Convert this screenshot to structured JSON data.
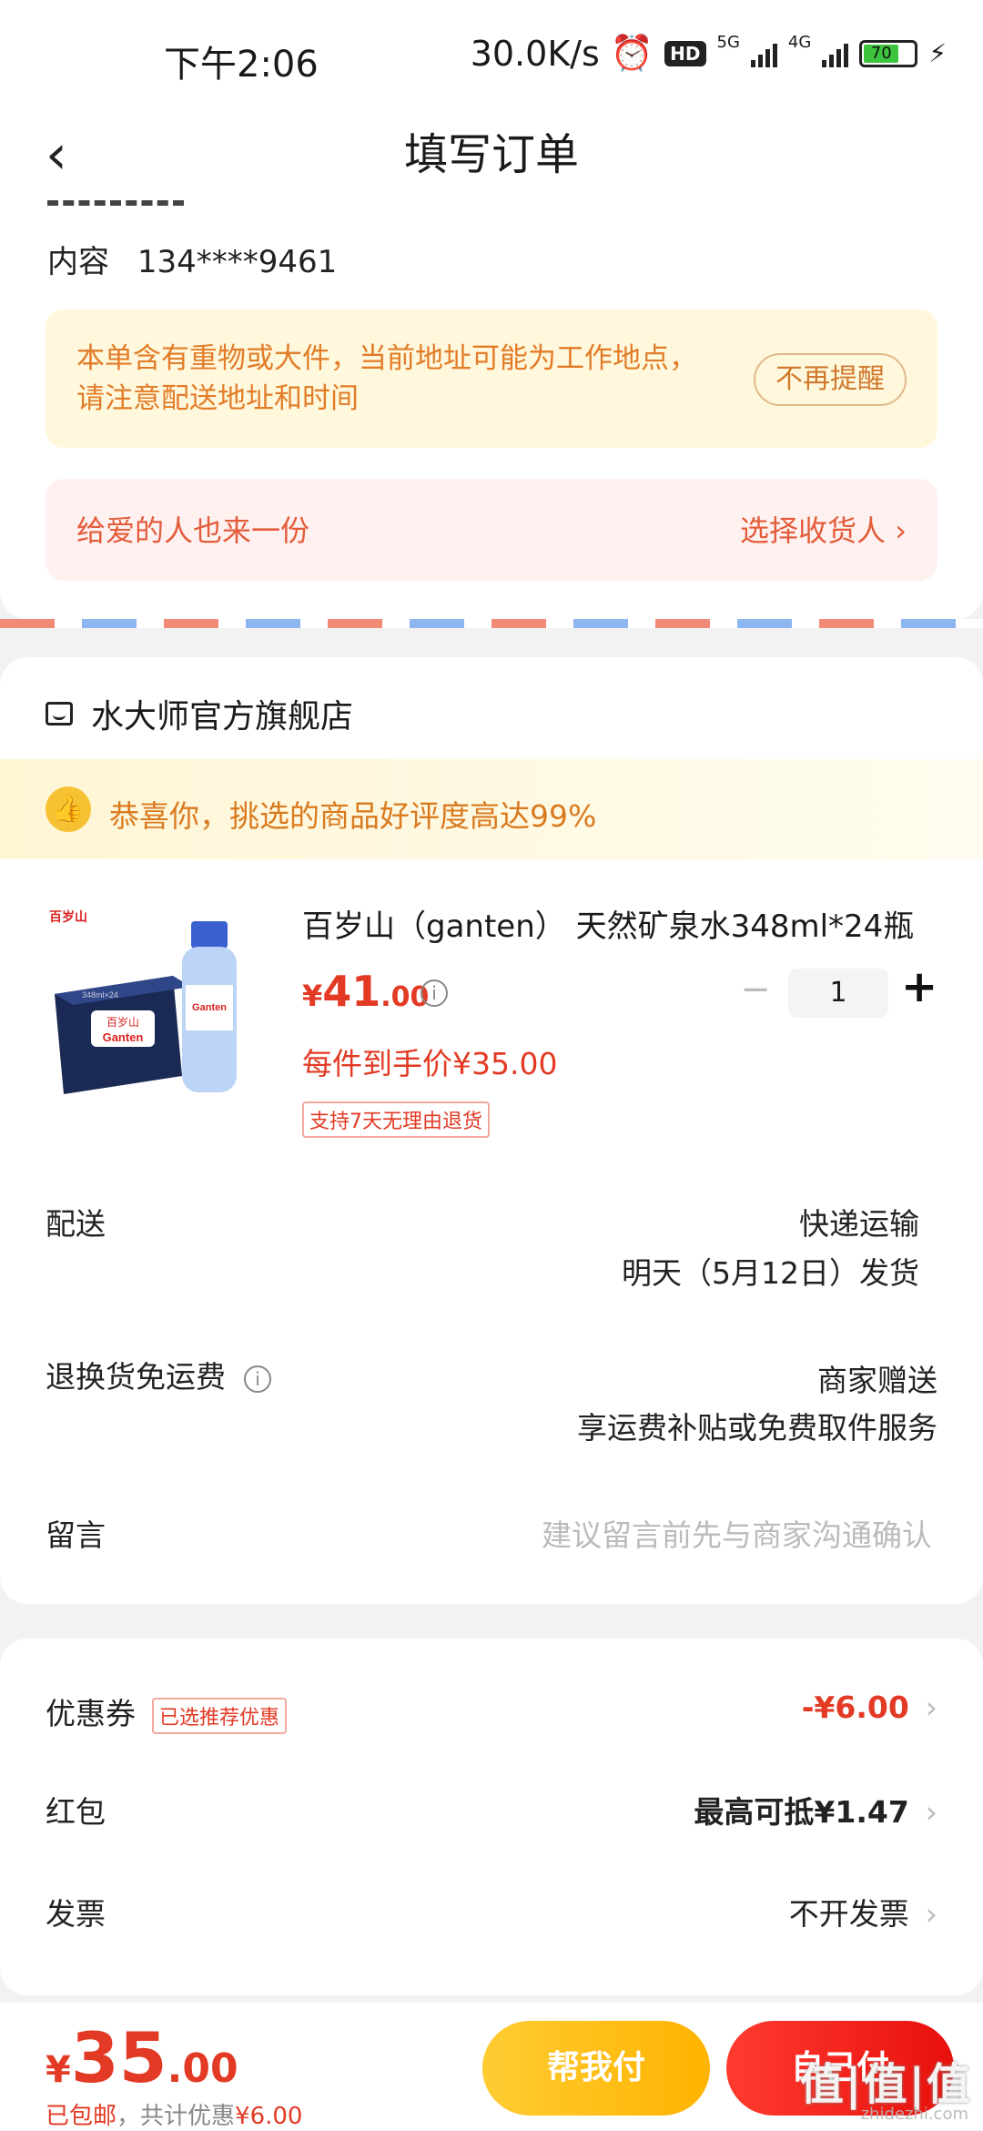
{
  "status_bar": {
    "time": "下午2:06",
    "speed": "30.0K/s",
    "hd": "HD",
    "net1": "5G",
    "net2": "4G",
    "battery": "70"
  },
  "header": {
    "back": "‹",
    "title": "填写订单"
  },
  "address": {
    "content_label": "内容",
    "phone": "134****9461"
  },
  "warning": {
    "text": "本单含有重物或大件，当前地址可能为工作地点，请注意配送地址和时间",
    "dismiss": "不再提醒"
  },
  "gift": {
    "left": "给爱的人也来一份",
    "right": "选择收货人 ›"
  },
  "store": {
    "name": "水大师官方旗舰店"
  },
  "praise": {
    "icon": "thumbs-up-icon",
    "text": "恭喜你，挑选的商品好评度高达99%"
  },
  "product": {
    "name": "百岁山（ganten） 天然矿泉水348ml*24瓶",
    "price_currency": "¥",
    "price_int": "41",
    "price_dec": ".00",
    "per_price": "每件到手价¥35.00",
    "return_tag": "支持7天无理由退货",
    "qty_minus": "−",
    "qty": "1",
    "qty_plus": "+",
    "img_box_label": "348ml×24",
    "img_brand": "百岁山",
    "img_logo": "Ganten"
  },
  "delivery": {
    "label": "配送",
    "method": "快递运输",
    "date": "明天（5月12日）发货"
  },
  "return_shipping": {
    "label": "退换货免运费",
    "value": "商家赠送",
    "sub": "享运费补贴或免费取件服务"
  },
  "message": {
    "label": "留言",
    "placeholder": "建议留言前先与商家沟通确认"
  },
  "discounts": {
    "coupon_label": "优惠券",
    "coupon_tag": "已选推荐优惠",
    "coupon_value": "-¥6.00",
    "redpacket_label": "红包",
    "redpacket_value": "最高可抵¥1.47",
    "invoice_label": "发票",
    "invoice_value": "不开发票",
    "chevron": "›"
  },
  "bottom": {
    "currency": "¥",
    "total_int": "35",
    "total_dec": ".00",
    "free_ship": "已包邮",
    "saving_prefix": "，共计优惠",
    "saving_value": "¥6.00",
    "help_pay": "帮我付",
    "self_pay": "自己付"
  },
  "watermark": {
    "text": "值|值|值",
    "sub": "zhidezhi.com"
  },
  "colors": {
    "accent_red": "#e23a24",
    "warn_orange": "#e27c28",
    "yellow": "#ffc21a"
  }
}
